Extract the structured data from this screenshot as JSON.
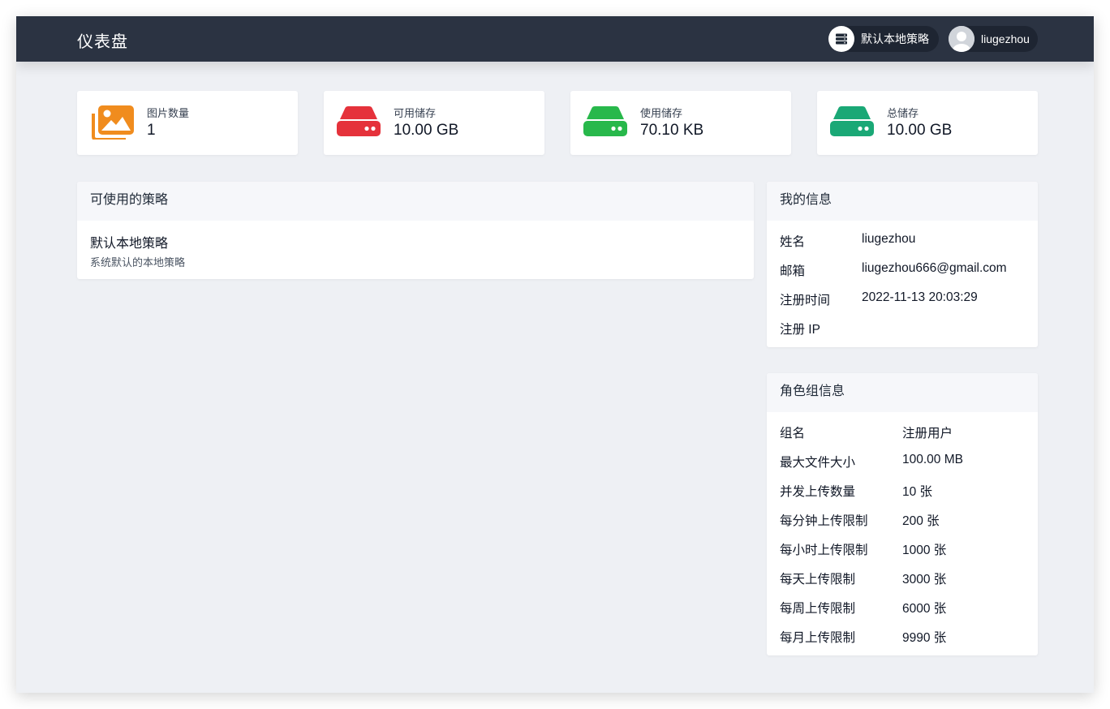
{
  "header": {
    "title": "仪表盘",
    "strategy_label": "默认本地策略",
    "username": "liugezhou"
  },
  "stats": [
    {
      "label": "图片数量",
      "value": "1",
      "icon": "images-icon",
      "color": "#f08c1e"
    },
    {
      "label": "可用储存",
      "value": "10.00 GB",
      "icon": "hard-drive-icon",
      "color": "#e5323b"
    },
    {
      "label": "使用储存",
      "value": "70.10 KB",
      "icon": "hard-drive-icon",
      "color": "#28b84b"
    },
    {
      "label": "总储存",
      "value": "10.00 GB",
      "icon": "hard-drive-icon",
      "color": "#1aa876"
    }
  ],
  "strategies": {
    "title": "可使用的策略",
    "items": [
      {
        "name": "默认本地策略",
        "description": "系统默认的本地策略"
      }
    ]
  },
  "my_info": {
    "title": "我的信息",
    "rows": [
      {
        "key": "姓名",
        "value": "liugezhou"
      },
      {
        "key": "邮箱",
        "value": "liugezhou666@gmail.com"
      },
      {
        "key": "注册时间",
        "value": "2022-11-13 20:03:29"
      },
      {
        "key": "注册 IP",
        "value": ""
      }
    ]
  },
  "role_info": {
    "title": "角色组信息",
    "rows": [
      {
        "key": "组名",
        "value": "注册用户"
      },
      {
        "key": "最大文件大小",
        "value": "100.00 MB"
      },
      {
        "key": "并发上传数量",
        "value": "10 张"
      },
      {
        "key": "每分钟上传限制",
        "value": "200 张"
      },
      {
        "key": "每小时上传限制",
        "value": "1000 张"
      },
      {
        "key": "每天上传限制",
        "value": "3000 张"
      },
      {
        "key": "每周上传限制",
        "value": "6000 张"
      },
      {
        "key": "每月上传限制",
        "value": "9990 张"
      }
    ]
  }
}
